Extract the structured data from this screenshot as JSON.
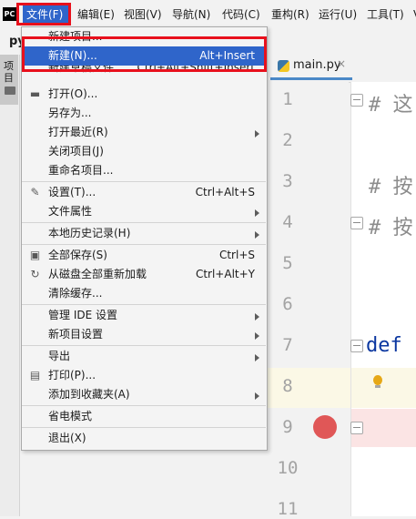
{
  "menubar": {
    "logo": "PC",
    "items": [
      "文件(F)",
      "编辑(E)",
      "视图(V)",
      "导航(N)",
      "代码(C)",
      "重构(R)",
      "运行(U)",
      "工具(T)",
      "V"
    ]
  },
  "project": {
    "name": "py",
    "tool_tab_label": "项目"
  },
  "editor": {
    "tab_label": "main.py",
    "line_numbers": [
      "1",
      "2",
      "3",
      "4",
      "5",
      "6",
      "7",
      "8",
      "9",
      "10",
      "11"
    ],
    "code_lines": {
      "line1": "# 这",
      "line3": "# 按",
      "line4": "# 按",
      "line7": "def"
    }
  },
  "file_menu": {
    "items": [
      {
        "label": "新建项目...",
        "shortcut": ""
      },
      {
        "label": "新建(N)...",
        "shortcut": "Alt+Insert"
      },
      {
        "label": "新建草稿文件",
        "shortcut": "Ctrl+Alt+Shift+Insert"
      },
      {
        "label": "打开(O)...",
        "shortcut": ""
      },
      {
        "label": "另存为...",
        "shortcut": ""
      },
      {
        "label": "打开最近(R)",
        "shortcut": ""
      },
      {
        "label": "关闭项目(J)",
        "shortcut": ""
      },
      {
        "label": "重命名项目...",
        "shortcut": ""
      },
      {
        "label": "设置(T)...",
        "shortcut": "Ctrl+Alt+S"
      },
      {
        "label": "文件属性",
        "shortcut": ""
      },
      {
        "label": "本地历史记录(H)",
        "shortcut": ""
      },
      {
        "label": "全部保存(S)",
        "shortcut": "Ctrl+S"
      },
      {
        "label": "从磁盘全部重新加载",
        "shortcut": "Ctrl+Alt+Y"
      },
      {
        "label": "清除缓存...",
        "shortcut": ""
      },
      {
        "label": "管理 IDE 设置",
        "shortcut": ""
      },
      {
        "label": "新项目设置",
        "shortcut": ""
      },
      {
        "label": "导出",
        "shortcut": ""
      },
      {
        "label": "打印(P)...",
        "shortcut": ""
      },
      {
        "label": "添加到收藏夹(A)",
        "shortcut": ""
      },
      {
        "label": "省电模式",
        "shortcut": ""
      },
      {
        "label": "退出(X)",
        "shortcut": ""
      }
    ]
  },
  "colors": {
    "selection": "#2f65ca",
    "annotation_box": "#e8101c",
    "breakpoint": "#e05757"
  }
}
